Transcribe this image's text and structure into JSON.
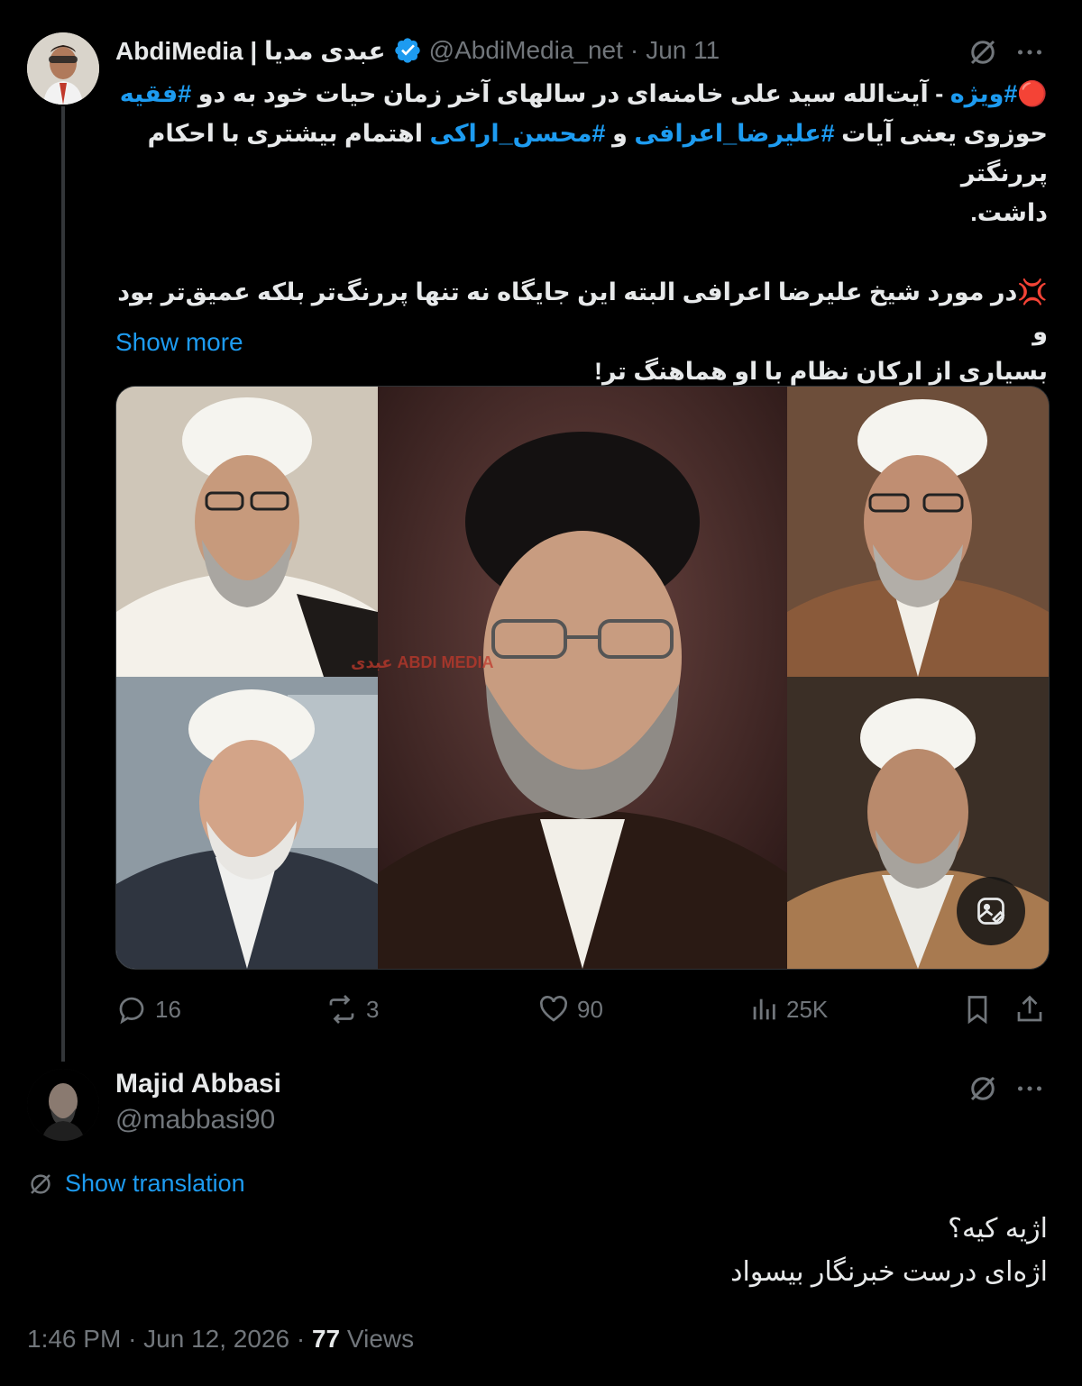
{
  "tweet": {
    "display_name": "AbdiMedia | عبدی مدیا",
    "handle": "@AbdiMedia_net",
    "separator": "·",
    "date": "Jun 11",
    "verified": true,
    "lines": [
      {
        "parts": [
          {
            "t": "🔴",
            "tag": false
          },
          {
            "t": "#ویژه",
            "tag": true
          },
          {
            "t": " - آیت‌الله سید علی خامنه‌ای در سالهای آخر زمان حیات خود به دو ",
            "tag": false
          },
          {
            "t": "#فقیه",
            "tag": true
          }
        ]
      },
      {
        "parts": [
          {
            "t": "حوزوی یعنی آیات ",
            "tag": false
          },
          {
            "t": "#علیرضا_اعرافی",
            "tag": true
          },
          {
            "t": " و ",
            "tag": false
          },
          {
            "t": "#محسن_اراکی",
            "tag": true
          },
          {
            "t": " اهتمام بیشتری با احکام پررنگتر",
            "tag": false
          }
        ]
      },
      {
        "parts": [
          {
            "t": "داشت.",
            "tag": false
          }
        ]
      },
      {
        "gap": true
      },
      {
        "parts": [
          {
            "t": "💢در مورد شیخ علیرضا اعرافی البته این جایگاه نه تنها پررنگ‌تر بلکه عمیق‌تر بود و",
            "tag": false
          }
        ]
      },
      {
        "parts": [
          {
            "t": "بسیاری از ارکان نظام با او هماهنگ تر!",
            "tag": false
          }
        ]
      }
    ],
    "show_more": "Show more",
    "media_alt": "Collage of five clerics portraits",
    "watermark": "عبدی ABDI MEDIA",
    "stats": {
      "replies": "16",
      "reposts": "3",
      "likes": "90",
      "views": "25K"
    }
  },
  "reply": {
    "display_name": "Majid Abbasi",
    "handle": "@mabbasi90",
    "show_translation": "Show translation",
    "lines": [
      "اژیه کیه؟",
      "اژه‌ای درست خبرنگار بیسواد"
    ],
    "time": "1:46 PM",
    "date": "Jun 12, 2026",
    "views_count": "77",
    "views_label": "Views",
    "sep": "·"
  },
  "colors": {
    "accent": "#1d9bf0",
    "muted": "#71767b",
    "background": "#000000",
    "text": "#e7e9ea"
  },
  "icons": [
    "grok-slash-icon",
    "more-icon",
    "verified-badge-icon",
    "reply-icon",
    "repost-icon",
    "like-icon",
    "views-icon",
    "bookmark-icon",
    "share-icon",
    "alt-text-icon",
    "translate-icon"
  ]
}
